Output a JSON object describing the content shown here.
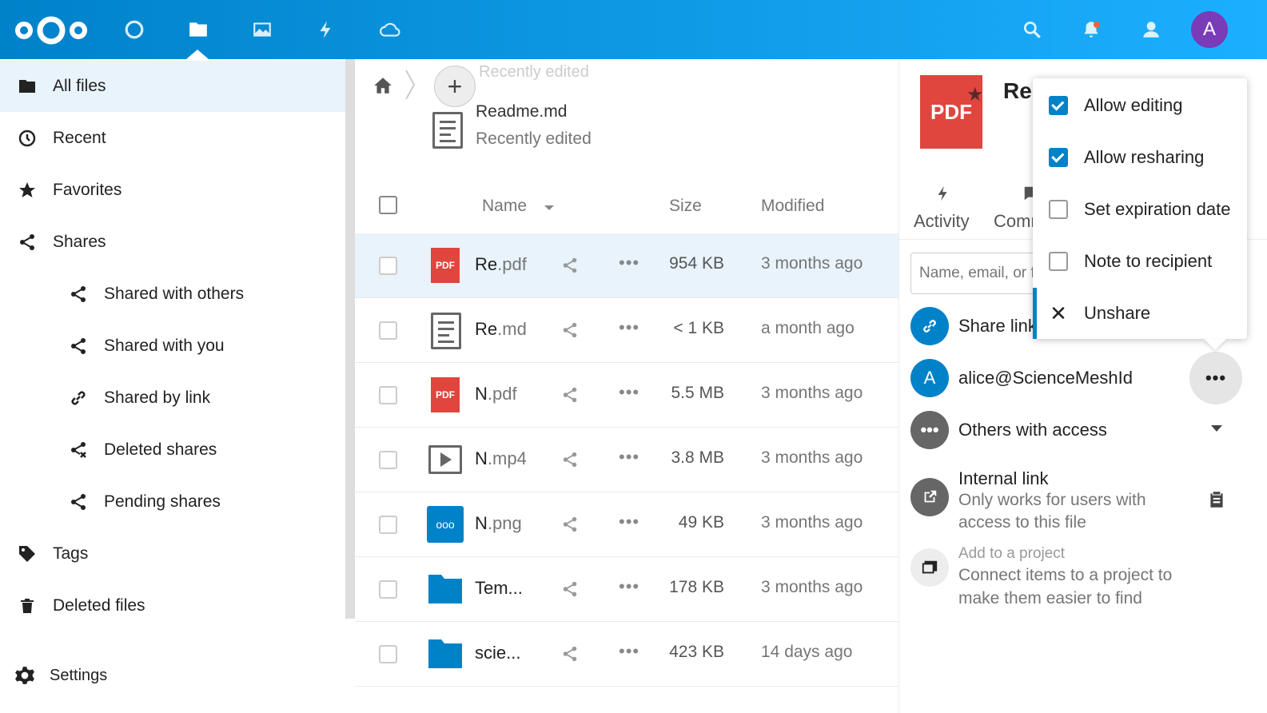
{
  "header": {
    "avatar_letter": "A",
    "accent_color": "#0082c9",
    "apps": [
      "dashboard-icon",
      "files-icon",
      "photos-icon",
      "activity-icon",
      "cloud-icon"
    ]
  },
  "nav": {
    "items": [
      {
        "label": "All files"
      },
      {
        "label": "Recent"
      },
      {
        "label": "Favorites"
      },
      {
        "label": "Shares"
      },
      {
        "label": "Shared with others"
      },
      {
        "label": "Shared with you"
      },
      {
        "label": "Shared by link"
      },
      {
        "label": "Deleted shares"
      },
      {
        "label": "Pending shares"
      },
      {
        "label": "Tags"
      },
      {
        "label": "Deleted files"
      }
    ],
    "settings": "Settings"
  },
  "files": {
    "recent_ghost": "Recently edited",
    "recent_name": "Readme.md",
    "recent_sub": "Recently edited",
    "columns": {
      "name": "Name",
      "size": "Size",
      "modified": "Modified"
    },
    "rows": [
      {
        "name": "Re",
        "ext": ".pdf",
        "size": "954 KB",
        "modified": "3 months ago"
      },
      {
        "name": "Re",
        "ext": ".md",
        "size": "< 1 KB",
        "modified": "a month ago"
      },
      {
        "name": "N",
        "ext": ".pdf",
        "size": "5.5 MB",
        "modified": "3 months ago"
      },
      {
        "name": "N",
        "ext": ".mp4",
        "size": "3.8 MB",
        "modified": "3 months ago"
      },
      {
        "name": "N",
        "ext": ".png",
        "size": "49 KB",
        "modified": "3 months ago"
      },
      {
        "name": "Tem...",
        "ext": "",
        "size": "178 KB",
        "modified": "3 months ago"
      },
      {
        "name": "scie...",
        "ext": "",
        "size": "423 KB",
        "modified": "14 days ago"
      }
    ],
    "more": "•••"
  },
  "sidebar": {
    "title": "Re",
    "pdf_label": "PDF",
    "tabs": {
      "activity": "Activity",
      "comments": "Comm"
    },
    "search_placeholder": "Name, email, or f",
    "share_link": "Share link",
    "user_share_letter": "A",
    "user_share": "alice@ScienceMeshId",
    "others": "Others with access",
    "internal_link": "Internal link",
    "internal_sub1": "Only works for users with",
    "internal_sub2": "access to this file",
    "project_title": "Add to a project",
    "project_sub1": "Connect items to a project to",
    "project_sub2": "make them easier to find"
  },
  "popover": {
    "items": [
      {
        "label": "Allow editing",
        "checked": true
      },
      {
        "label": "Allow resharing",
        "checked": true
      },
      {
        "label": "Set expiration date",
        "checked": false
      },
      {
        "label": "Note to recipient",
        "checked": false
      }
    ],
    "unshare": "Unshare"
  }
}
